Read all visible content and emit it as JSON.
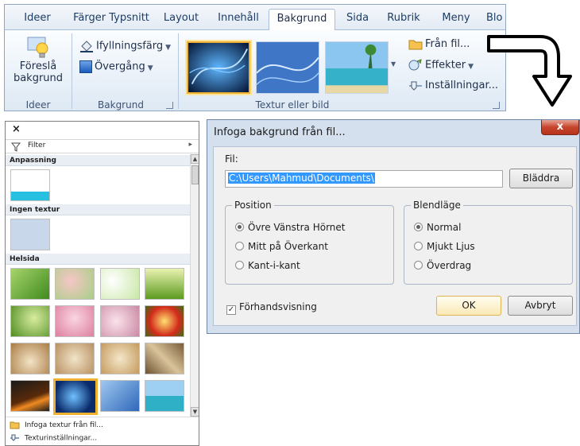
{
  "ribbon": {
    "tabs": [
      "Ideer",
      "Färger Typsnitt",
      "Layout",
      "Innehåll",
      "Bakgrund",
      "Sida",
      "Rubrik",
      "Meny",
      "Blo"
    ],
    "active_tab": "Bakgrund",
    "ideas_group": {
      "button_line1": "Föreslå",
      "button_line2": "bakgrund",
      "label": "Ideer"
    },
    "background_group": {
      "fill_color": "Ifyllningsfärg",
      "gradient": "Övergång",
      "label": "Bakgrund"
    },
    "texture_group": {
      "label": "Textur eller bild",
      "from_file": "Från fil...",
      "effects": "Effekter",
      "settings": "Inställningar..."
    }
  },
  "panel": {
    "close": "×",
    "filter": "Filter",
    "sections": {
      "fit": "Anpassning",
      "no_texture": "Ingen textur",
      "full_page": "Helsida"
    },
    "actions": {
      "insert_texture": "Infoga textur från fil...",
      "texture_settings": "Texturinställningar..."
    }
  },
  "dialog": {
    "title": "Infoga bakgrund från fil...",
    "close": "x",
    "file_label": "Fil:",
    "file_value": "C:\\Users\\Mahmud\\Documents\\",
    "browse": "Bläddra",
    "position": {
      "legend": "Position",
      "options": [
        "Övre Vänstra Hörnet",
        "Mitt på Överkant",
        "Kant-i-kant"
      ],
      "selected": 0
    },
    "blend": {
      "legend": "Blendläge",
      "options": [
        "Normal",
        "Mjukt Ljus",
        "Överdrag"
      ],
      "selected": 0
    },
    "preview": "Förhandsvisning",
    "ok": "OK",
    "cancel": "Avbryt"
  },
  "colors": {
    "accent_selection": "#f0b030",
    "text_selection": "#3399ff",
    "close_button": "#c7442c",
    "ribbon_border": "#8fa6c3"
  }
}
